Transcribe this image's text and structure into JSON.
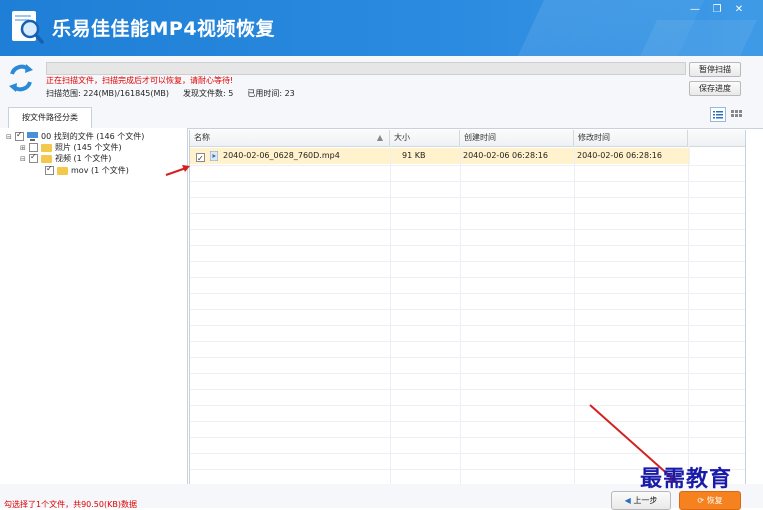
{
  "app": {
    "title": "乐易佳佳能MP4视频恢复"
  },
  "window_controls": {
    "minimize": "—",
    "restore": "❐",
    "close": "✕"
  },
  "scan": {
    "progress": 0.0,
    "message": "正在扫描文件，扫描完成后才可以恢复，请耐心等待!",
    "range": "扫描范围: 224(MB)/161845(MB)",
    "found": "发现文件数: 5",
    "elapsed": "已用时间: 23"
  },
  "buttons": {
    "pause_scan": "暂停扫描",
    "save_progress": "保存进度",
    "prev": "上一步",
    "recover": "恢复"
  },
  "tabs": [
    {
      "label": "按文件路径分类"
    }
  ],
  "tree": [
    {
      "label": "00 找到的文件 (146 个文件)",
      "checked": true
    },
    {
      "label": "照片  (145 个文件)",
      "checked": false
    },
    {
      "label": "视频  (1 个文件)",
      "checked": true
    },
    {
      "label": "mov   (1 个文件)",
      "checked": true
    }
  ],
  "file_list": {
    "columns": [
      "名称",
      "大小",
      "创建时间",
      "修改时间"
    ],
    "rows": [
      {
        "name": "2040-02-06_0628_760D.mp4",
        "size": "91 KB",
        "created": "2040-02-06  06:28:16",
        "modified": "2040-02-06  06:28:16",
        "checked": true
      }
    ]
  },
  "footer": {
    "message": "勾选择了1个文件，共90.50(KB)数据"
  },
  "watermark": "最需教育",
  "colors": {
    "titlebar": "#2b8be0",
    "selected_row": "#fff2cc",
    "warning_text": "#e00000",
    "recover_button": "#f5821f",
    "arrow": "#d42020"
  }
}
